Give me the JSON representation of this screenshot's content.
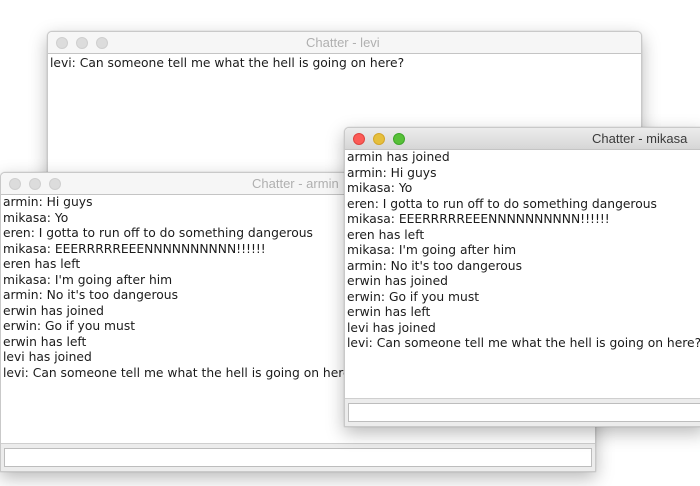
{
  "windows": {
    "levi": {
      "title": "Chatter - levi",
      "messages": [
        "levi: Can someone tell me what the hell is going on here?"
      ],
      "input_value": ""
    },
    "armin": {
      "title": "Chatter - armin",
      "messages": [
        "armin: Hi guys",
        "mikasa: Yo",
        "eren: I gotta to run off to do something dangerous",
        "mikasa: EEERRRRREEENNNNNNNNNN!!!!!!",
        "eren has left",
        "mikasa: I'm going after him",
        "armin: No it's too dangerous",
        "erwin has joined",
        "erwin: Go if you must",
        "erwin has left",
        "levi has joined",
        "levi: Can someone tell me what the hell is going on here?"
      ],
      "input_value": ""
    },
    "mikasa": {
      "title": "Chatter - mikasa",
      "messages": [
        "armin has joined",
        "armin: Hi guys",
        "mikasa: Yo",
        "eren: I gotta to run off to do something dangerous",
        "mikasa: EEERRRRREEENNNNNNNNNN!!!!!!",
        "eren has left",
        "mikasa: I'm going after him",
        "armin: No it's too dangerous",
        "erwin has joined",
        "erwin: Go if you must",
        "erwin has left",
        "levi has joined",
        "levi: Can someone tell me what the hell is going on here?"
      ],
      "input_value": ""
    }
  },
  "colors": {
    "close": "#fc5b57",
    "minimize": "#e5bf3c",
    "zoom": "#57c038",
    "inactive_light": "#dcdcdc"
  }
}
